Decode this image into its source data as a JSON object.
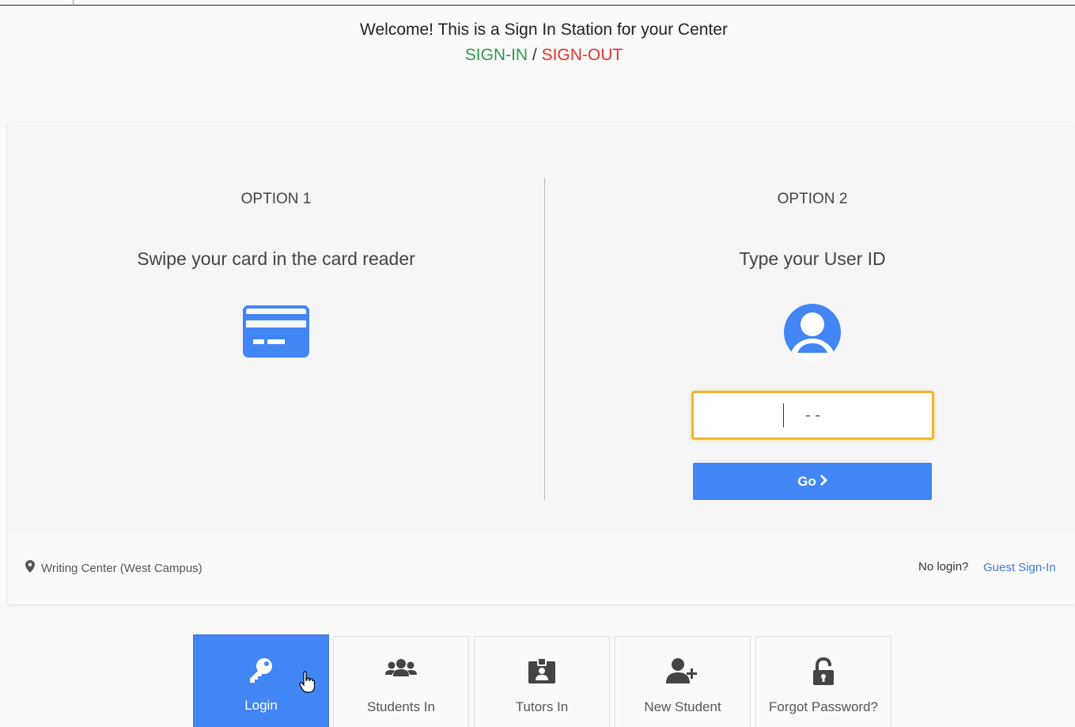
{
  "header": {
    "welcome": "Welcome! This is a  Sign In Station for your Center",
    "sign_in": "SIGN-IN",
    "separator": " / ",
    "sign_out": "SIGN-OUT"
  },
  "option1": {
    "title": "OPTION 1",
    "description": "Swipe your card in the card reader",
    "icon": "credit-card-icon"
  },
  "option2": {
    "title": "OPTION 2",
    "description": "Type your User ID",
    "icon": "user-circle-icon",
    "input_value": "- -",
    "go_label": "Go"
  },
  "footer": {
    "location": "Writing Center (West Campus)",
    "no_login": "No login?",
    "guest_link": "Guest Sign-In"
  },
  "tabs": [
    {
      "label": "Login",
      "icon": "key-icon",
      "active": true
    },
    {
      "label": "Students In",
      "icon": "users-icon",
      "active": false
    },
    {
      "label": "Tutors In",
      "icon": "id-badge-icon",
      "active": false
    },
    {
      "label": "New Student",
      "icon": "user-plus-icon",
      "active": false
    },
    {
      "label": "Forgot Password?",
      "icon": "unlock-icon",
      "active": false
    }
  ],
  "colors": {
    "accent": "#4285f4",
    "sign_in": "#2e9a4a",
    "sign_out": "#e0342f",
    "input_focus": "#f0b429"
  }
}
